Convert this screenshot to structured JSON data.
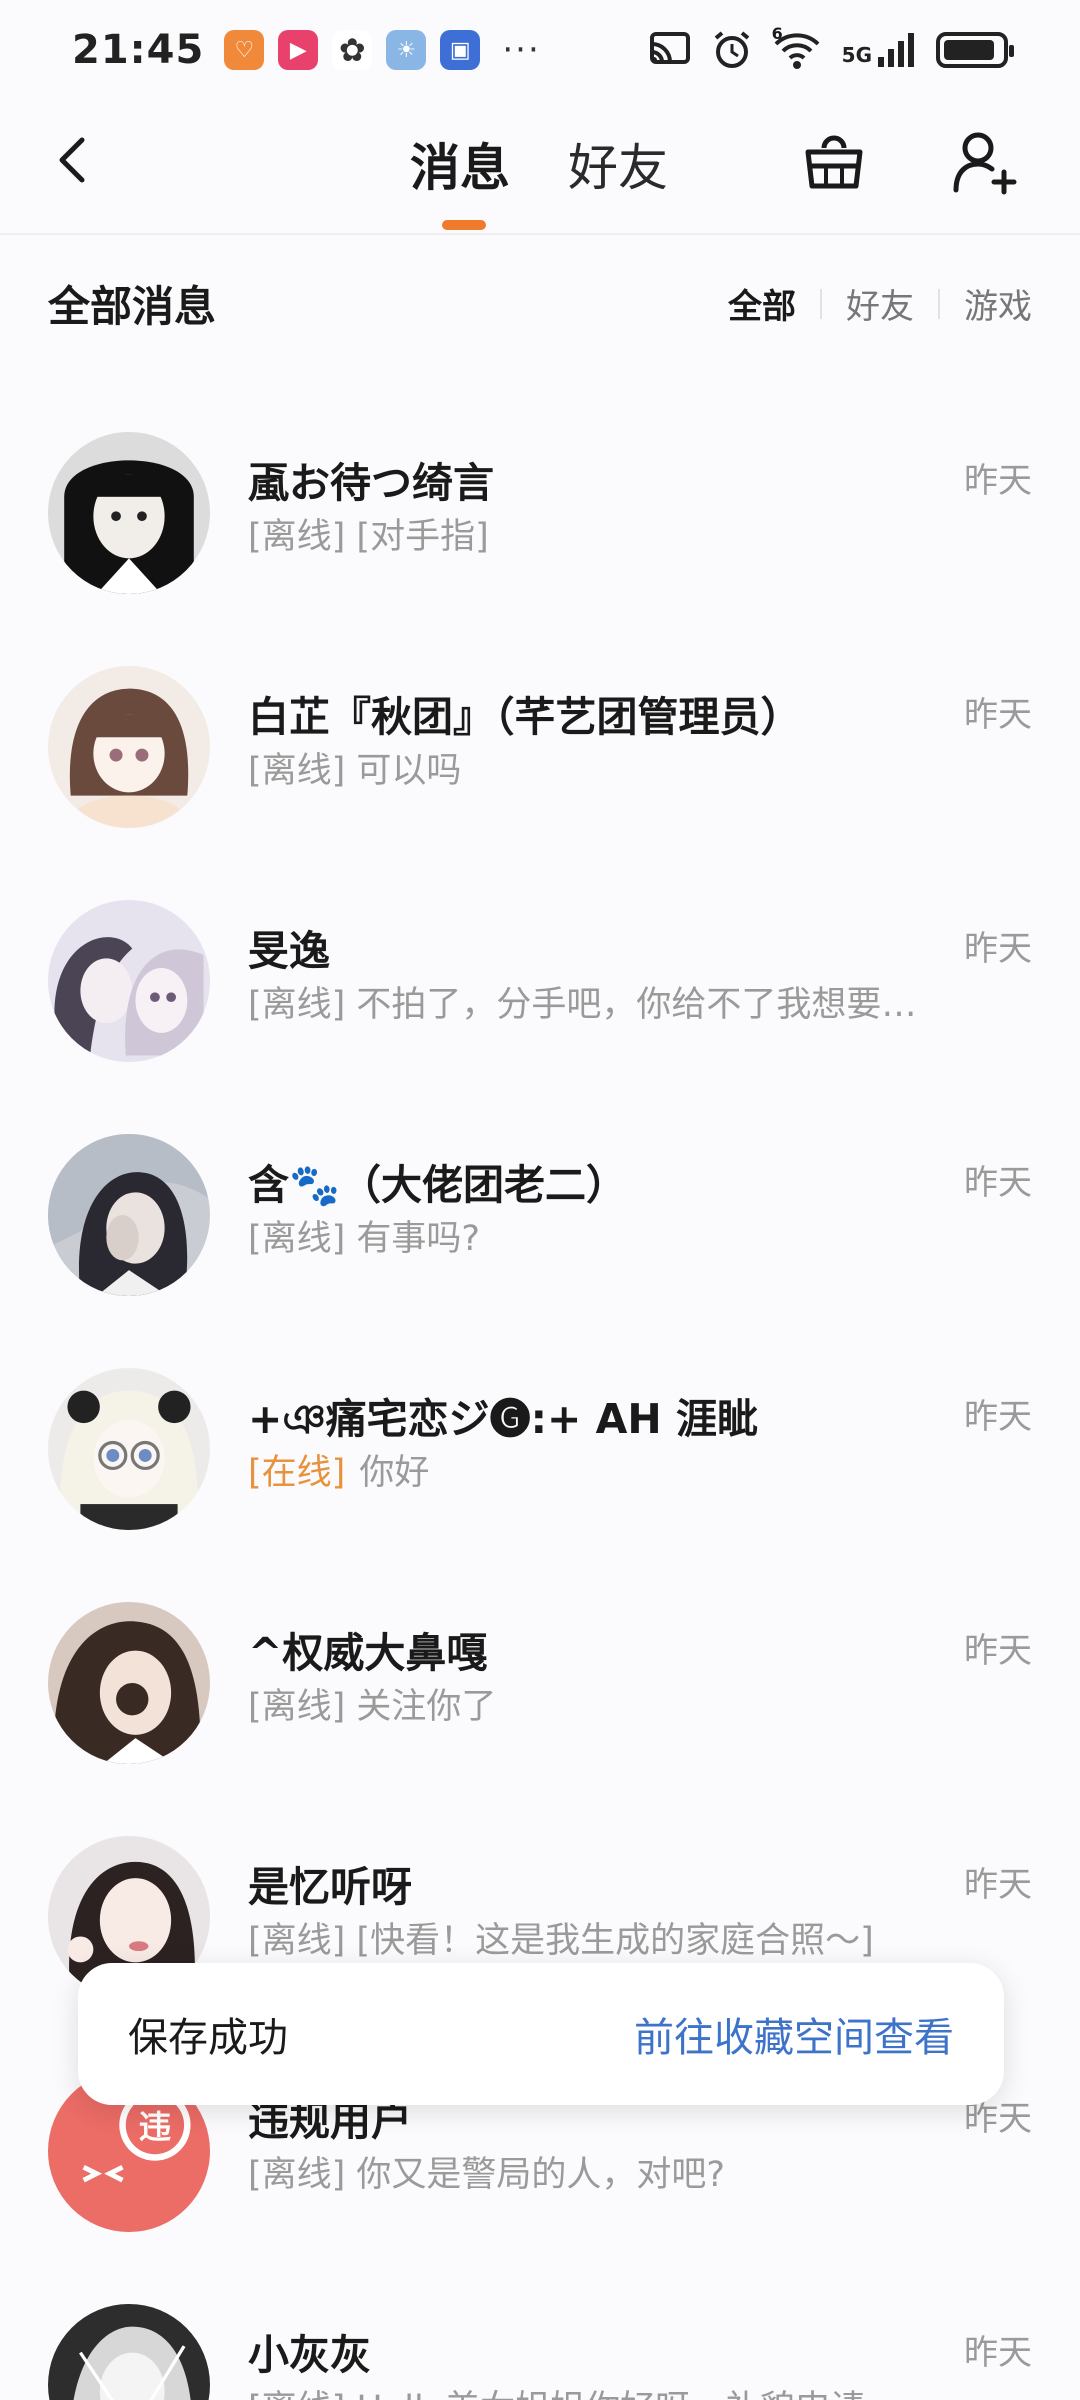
{
  "status_bar": {
    "time": "21:45",
    "more": "···",
    "network": "5G",
    "wifi_badge": "6",
    "app_icons": [
      {
        "name": "orange-app-icon",
        "color": "#f0893a",
        "glyph": "♡"
      },
      {
        "name": "video-app-icon",
        "color": "#e8416b",
        "glyph": "▶"
      },
      {
        "name": "wechat-icon",
        "color": "#4a4a4a",
        "glyph": "✿"
      },
      {
        "name": "weather-icon",
        "color": "#8ab6e6",
        "glyph": "☀"
      },
      {
        "name": "blue-app-icon",
        "color": "#3d6fd6",
        "glyph": "▣"
      }
    ]
  },
  "nav": {
    "tabs": [
      {
        "label": "消息",
        "active": true
      },
      {
        "label": "好友",
        "active": false
      }
    ],
    "accent": "#f07b2b"
  },
  "filter": {
    "title": "全部消息",
    "options": [
      {
        "label": "全部",
        "active": true
      },
      {
        "label": "好友",
        "active": false
      },
      {
        "label": "游戏",
        "active": false
      }
    ]
  },
  "messages": [
    {
      "name": "颪お待つ绮言",
      "status": "",
      "preview": "[离线] [对手指]",
      "time": "昨天",
      "online": false
    },
    {
      "name": "白芷『秋团』（芊艺团管理员）",
      "status": "",
      "preview": "[离线] 可以吗",
      "time": "昨天",
      "online": false
    },
    {
      "name": "旻逸",
      "status": "",
      "preview": "[离线] 不拍了，分手吧，你给不了我想要的…",
      "time": "昨天",
      "online": false
    },
    {
      "name": "含🐾（大佬团老二）",
      "status": "",
      "preview": "[离线] 有事吗?",
      "time": "昨天",
      "online": false
    },
    {
      "name": "+ঞ痛宅恋ジ🅖:+ AH 涯眦",
      "status": "[在线]",
      "preview": "你好",
      "time": "昨天",
      "online": true
    },
    {
      "name": "^权威大鼻嘎",
      "status": "",
      "preview": "[离线] 关注你了",
      "time": "昨天",
      "online": false
    },
    {
      "name": "是忆听呀",
      "status": "",
      "preview": "[离线] [快看！这是我生成的家庭合照～]",
      "time": "昨天",
      "online": false
    },
    {
      "name": "违规用户",
      "status": "",
      "preview": "[离线] 你又是警局的人，对吧?",
      "time": "昨天",
      "online": false
    },
    {
      "name": "小灰灰",
      "status": "",
      "preview": "[离线] Hello美女姐姐你好呀，礼貌申请",
      "time": "昨天",
      "online": false
    }
  ],
  "violation_badge": "违",
  "toast": {
    "text": "保存成功",
    "link": "前往收藏空间查看"
  }
}
